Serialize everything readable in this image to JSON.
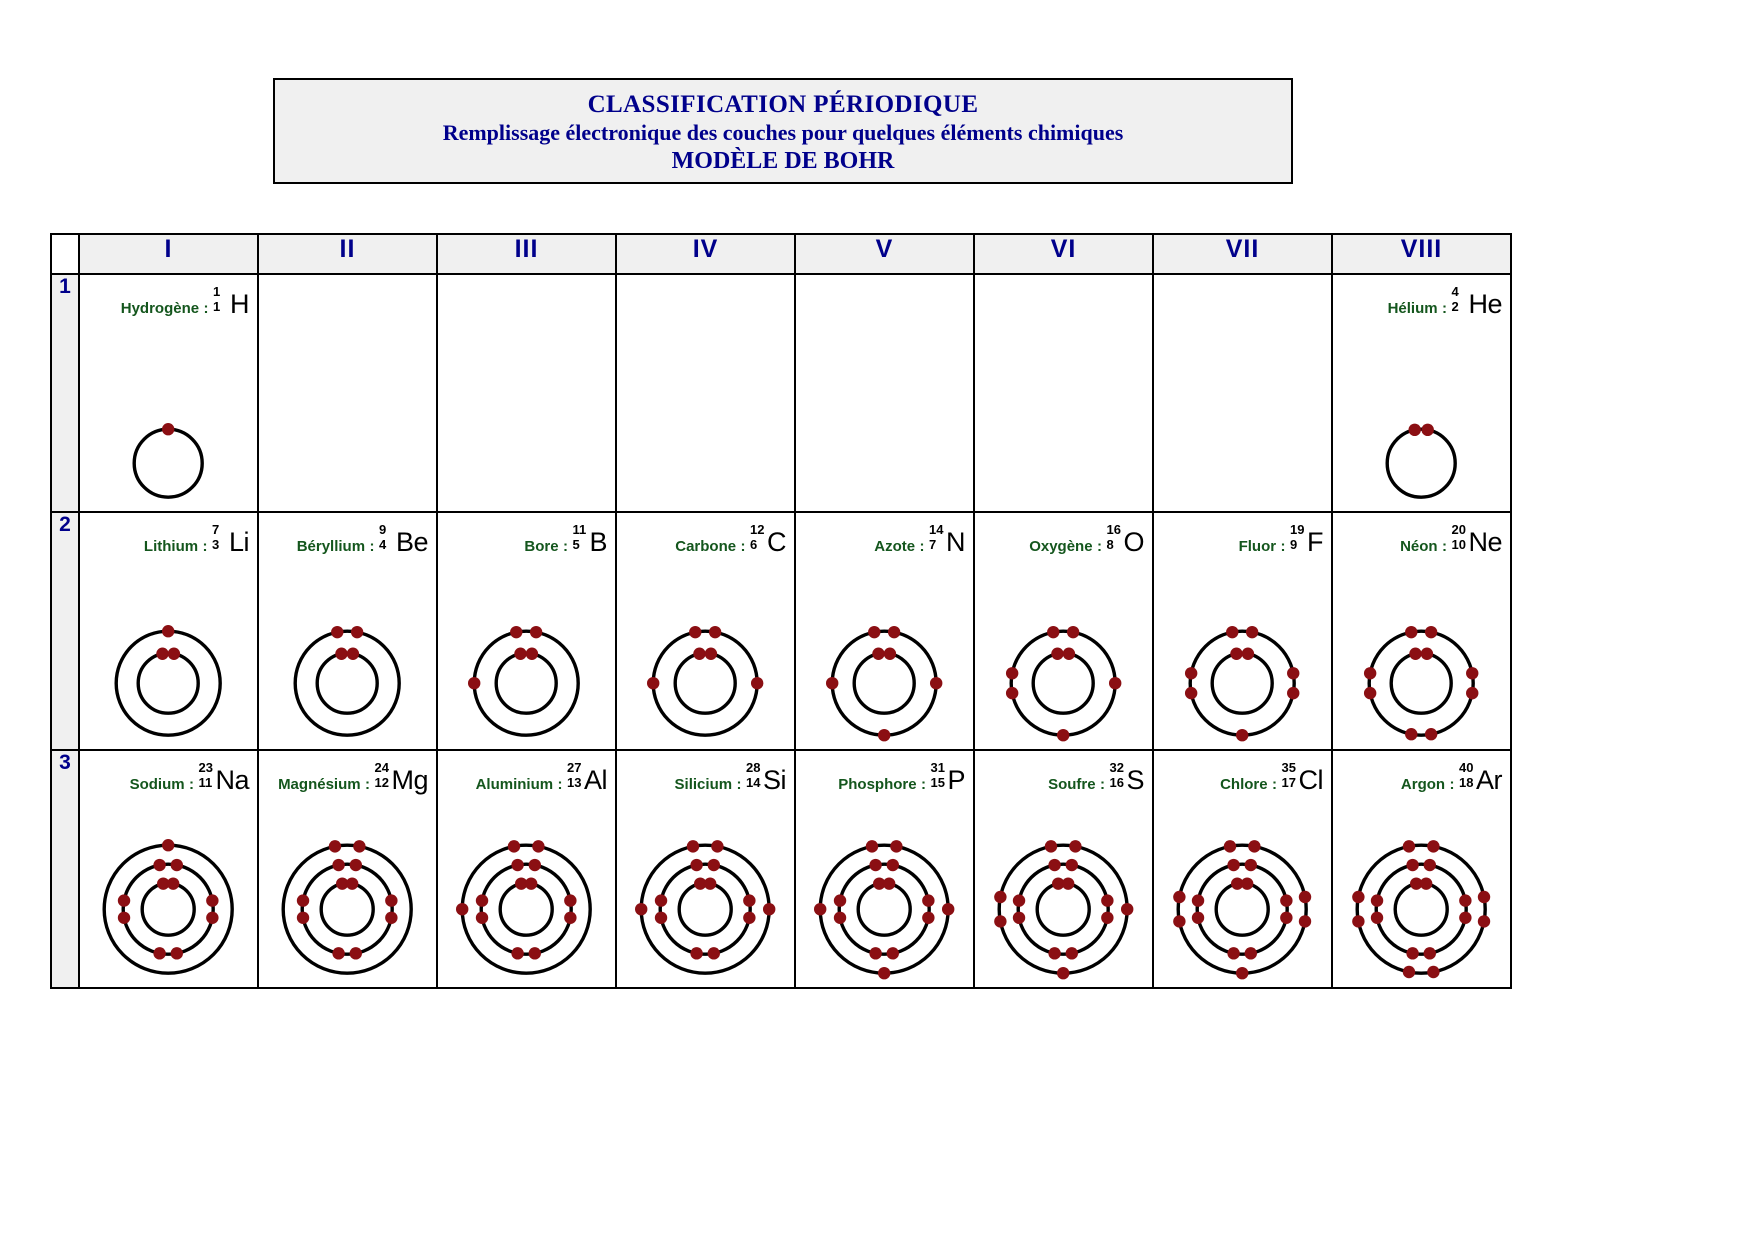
{
  "title": {
    "line1": "CLASSIFICATION PÉRIODIQUE",
    "line2": "Remplissage électronique des couches pour quelques éléments chimiques",
    "line3": "MODÈLE DE BOHR"
  },
  "colors": {
    "title_text": "#00008b",
    "header_text": "#00008b",
    "header_bg": "#f0f0f0",
    "element_name": "#14561d",
    "symbol": "#000000",
    "electron": "#8b0f13",
    "shell": "#000000",
    "border": "#000000"
  },
  "table": {
    "group_headers": [
      "I",
      "II",
      "III",
      "IV",
      "V",
      "VI",
      "VII",
      "VIII"
    ],
    "period_labels": [
      "1",
      "2",
      "3"
    ],
    "rows": [
      {
        "period": "1",
        "cells": [
          {
            "empty": false,
            "name": "Hydrogène",
            "separator": ":",
            "symbol": "H",
            "mass": "1",
            "z": "1",
            "shells": [
              1
            ]
          },
          {
            "empty": true
          },
          {
            "empty": true
          },
          {
            "empty": true
          },
          {
            "empty": true
          },
          {
            "empty": true
          },
          {
            "empty": true
          },
          {
            "empty": false,
            "name": "Hélium",
            "separator": ":",
            "symbol": "He",
            "mass": "4",
            "z": "2",
            "shells": [
              2
            ]
          }
        ]
      },
      {
        "period": "2",
        "cells": [
          {
            "empty": false,
            "name": "Lithium",
            "separator": ":",
            "symbol": "Li",
            "mass": "7",
            "z": "3",
            "shells": [
              2,
              1
            ]
          },
          {
            "empty": false,
            "name": "Béryllium",
            "separator": ":",
            "symbol": "Be",
            "mass": "9",
            "z": "4",
            "shells": [
              2,
              2
            ]
          },
          {
            "empty": false,
            "name": "Bore",
            "separator": ":",
            "symbol": "B",
            "mass": "11",
            "z": "5",
            "shells": [
              2,
              3
            ]
          },
          {
            "empty": false,
            "name": "Carbone",
            "separator": ":",
            "symbol": "C",
            "mass": "12",
            "z": "6",
            "shells": [
              2,
              4
            ]
          },
          {
            "empty": false,
            "name": "Azote",
            "separator": ":",
            "symbol": "N",
            "mass": "14",
            "z": "7",
            "shells": [
              2,
              5
            ]
          },
          {
            "empty": false,
            "name": "Oxygène",
            "separator": ":",
            "symbol": "O",
            "mass": "16",
            "z": "8",
            "shells": [
              2,
              6
            ]
          },
          {
            "empty": false,
            "name": "Fluor",
            "separator": ":",
            "symbol": "F",
            "mass": "19",
            "z": "9",
            "shells": [
              2,
              7
            ]
          },
          {
            "empty": false,
            "name": "Néon",
            "separator": ":",
            "symbol": "Ne",
            "mass": "20",
            "z": "10",
            "shells": [
              2,
              8
            ]
          }
        ]
      },
      {
        "period": "3",
        "cells": [
          {
            "empty": false,
            "name": "Sodium",
            "separator": ":",
            "symbol": "Na",
            "mass": "23",
            "z": "11",
            "shells": [
              2,
              8,
              1
            ]
          },
          {
            "empty": false,
            "name": "Magnésium",
            "separator": ":",
            "symbol": "Mg",
            "mass": "24",
            "z": "12",
            "shells": [
              2,
              8,
              2
            ]
          },
          {
            "empty": false,
            "name": "Aluminium",
            "separator": ":",
            "symbol": "Al",
            "mass": "27",
            "z": "13",
            "shells": [
              2,
              8,
              3
            ]
          },
          {
            "empty": false,
            "name": "Silicium",
            "separator": ":",
            "symbol": "Si",
            "mass": "28",
            "z": "14",
            "shells": [
              2,
              8,
              4
            ]
          },
          {
            "empty": false,
            "name": "Phosphore",
            "separator": ":",
            "symbol": "P",
            "mass": "31",
            "z": "15",
            "shells": [
              2,
              8,
              5
            ]
          },
          {
            "empty": false,
            "name": "Soufre",
            "separator": ":",
            "symbol": "S",
            "mass": "32",
            "z": "16",
            "shells": [
              2,
              8,
              6
            ]
          },
          {
            "empty": false,
            "name": "Chlore",
            "separator": ":",
            "symbol": "Cl",
            "mass": "35",
            "z": "17",
            "shells": [
              2,
              8,
              7
            ]
          },
          {
            "empty": false,
            "name": "Argon",
            "separator": ":",
            "symbol": "Ar",
            "mass": "40",
            "z": "18",
            "shells": [
              2,
              8,
              8
            ]
          }
        ]
      }
    ]
  }
}
